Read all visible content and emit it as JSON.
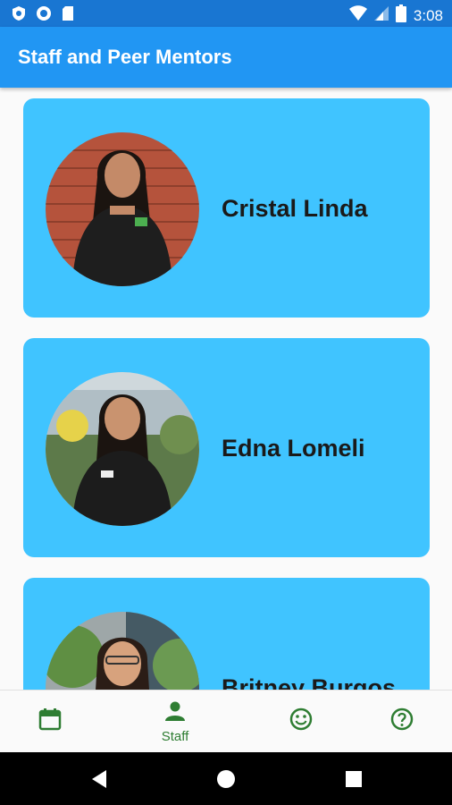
{
  "status_bar": {
    "time": "3:08",
    "icons": [
      "shield-icon",
      "circle-icon",
      "sd-card-icon",
      "wifi-icon",
      "signal-icon",
      "battery-icon"
    ]
  },
  "app_bar": {
    "title": "Staff and Peer Mentors"
  },
  "mentors": [
    {
      "name": "Cristal Linda"
    },
    {
      "name": "Edna Lomeli"
    },
    {
      "name": "Britney Burgos"
    }
  ],
  "bottom_nav": {
    "items": [
      {
        "icon": "calendar-icon",
        "label": ""
      },
      {
        "icon": "person-icon",
        "label": "Staff",
        "selected": true
      },
      {
        "icon": "smiley-icon",
        "label": ""
      },
      {
        "icon": "help-icon",
        "label": ""
      }
    ]
  },
  "colors": {
    "status_bar": "#1976d2",
    "app_bar": "#2196f3",
    "card": "#40c4ff",
    "nav_accent": "#2e7d32"
  }
}
